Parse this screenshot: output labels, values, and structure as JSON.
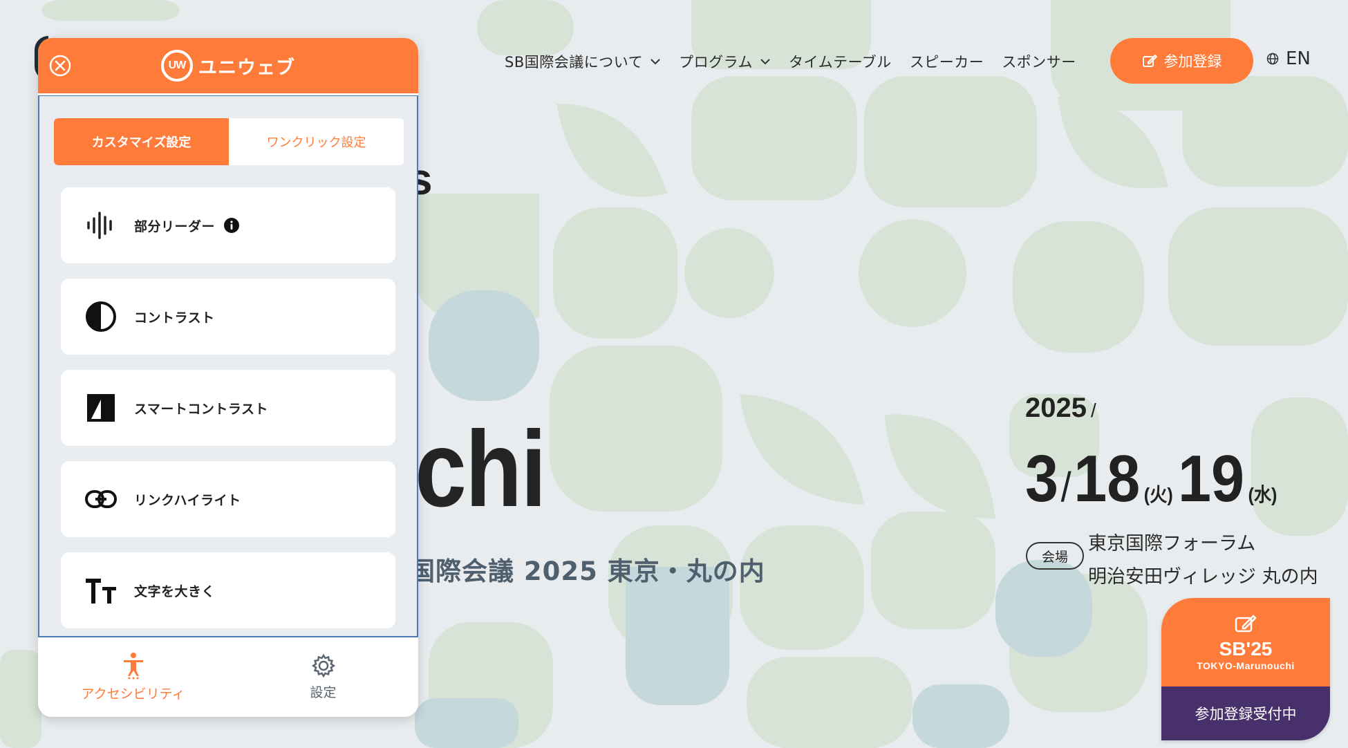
{
  "colors": {
    "accent": "#ff7b39",
    "panel_border": "#4d79b5",
    "card_purple": "#48306a",
    "text_dark": "#222222"
  },
  "site": {
    "nav": [
      {
        "label": "SB国際会議について",
        "has_dropdown": true
      },
      {
        "label": "プログラム",
        "has_dropdown": true
      },
      {
        "label": "タイムテーブル",
        "has_dropdown": false
      },
      {
        "label": "スピーカー",
        "has_dropdown": false
      },
      {
        "label": "スポンサー",
        "has_dropdown": false
      }
    ],
    "register_button": "参加登録",
    "language": "EN"
  },
  "hero": {
    "partial_s": "s",
    "title_fragment": "uchi",
    "subtitle_fragment": "国際会議 2025 東京・丸の内"
  },
  "event_date": {
    "year": "2025",
    "year_sep": "/",
    "month": "3",
    "date_sep": "/",
    "day1": "18",
    "dow1": "(火)",
    "day2": "19",
    "dow2": "(水)"
  },
  "venue": {
    "badge": "会場",
    "line1": "東京国際フォーラム",
    "line2": "明治安田ヴィレッジ 丸の内"
  },
  "sb_card": {
    "title": "SB'25",
    "subtitle": "TOKYO-Marunouchi",
    "status": "参加登録受付中",
    "icon": "edit-icon"
  },
  "panel": {
    "brand_mark": "UW",
    "brand_name": "ユニウェブ",
    "tabs": {
      "customize": "カスタマイズ設定",
      "one_click": "ワンクリック設定"
    },
    "options": [
      {
        "label": "部分リーダー",
        "icon": "audio-wave-icon",
        "has_info": true
      },
      {
        "label": "コントラスト",
        "icon": "contrast-icon",
        "has_info": false
      },
      {
        "label": "スマートコントラスト",
        "icon": "smart-contrast-icon",
        "has_info": false
      },
      {
        "label": "リンクハイライト",
        "icon": "link-icon",
        "has_info": false
      },
      {
        "label": "文字を大きく",
        "icon": "text-size-icon",
        "has_info": false
      }
    ],
    "footer": {
      "accessibility": "アクセシビリティ",
      "settings": "設定"
    }
  }
}
